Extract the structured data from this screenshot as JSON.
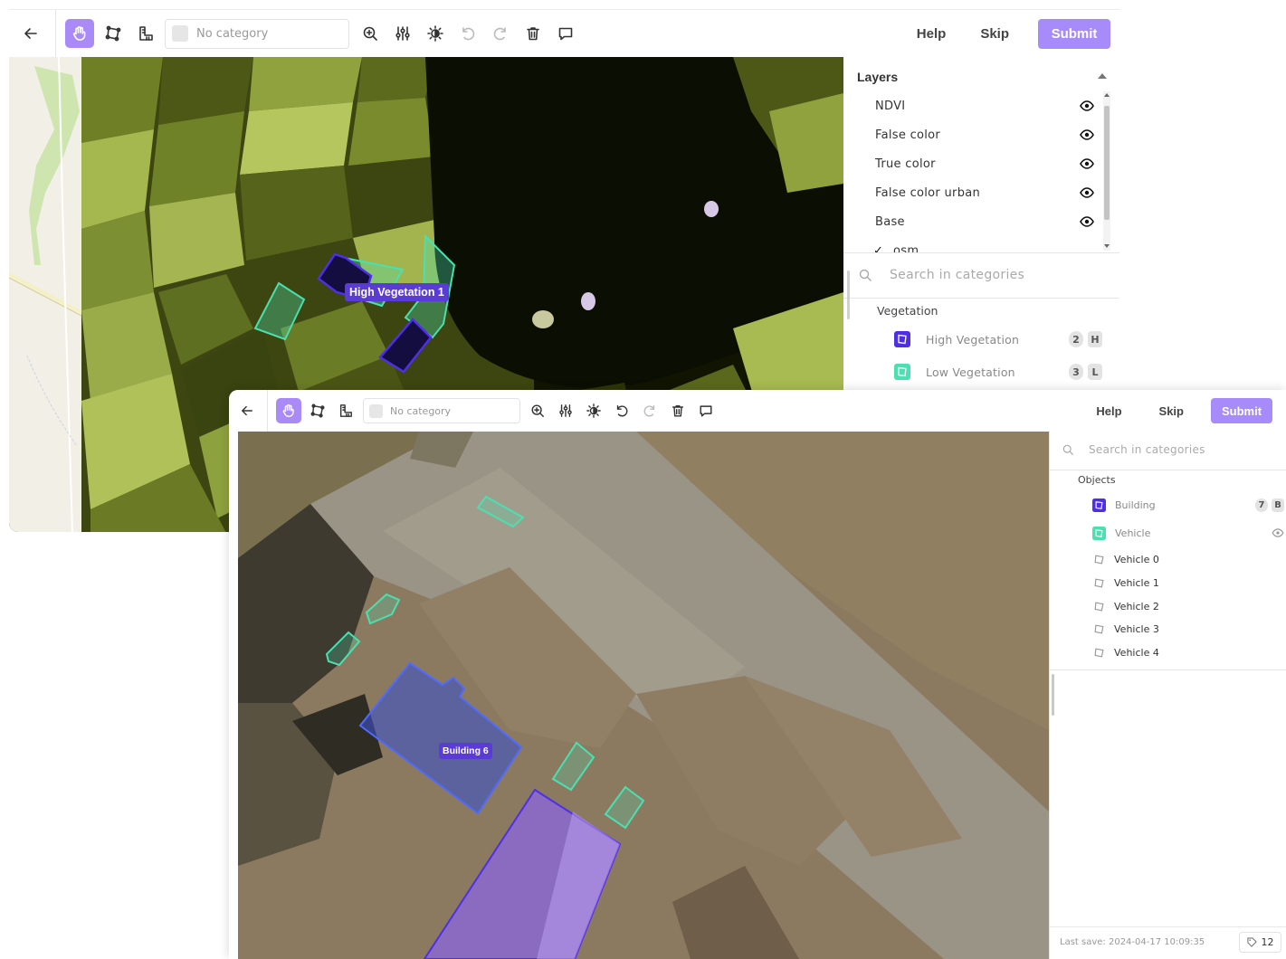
{
  "colors": {
    "accent": "#a78bfa",
    "high_vegetation": "#4f2ee8",
    "low_vegetation": "#4ae0b0",
    "building": "#4f2ee8",
    "vehicle": "#4ae0b0"
  },
  "window1": {
    "toolbar": {
      "category_placeholder": "No category",
      "help_label": "Help",
      "skip_label": "Skip",
      "submit_label": "Submit"
    },
    "layers": {
      "title": "Layers",
      "items": [
        {
          "label": "NDVI",
          "visible": true
        },
        {
          "label": "False color",
          "visible": true
        },
        {
          "label": "True color",
          "visible": true
        },
        {
          "label": "False color urban",
          "visible": true
        },
        {
          "label": "Base",
          "visible": true
        },
        {
          "label": "osm",
          "checked": true
        }
      ]
    },
    "search": {
      "placeholder": "Search in categories"
    },
    "categories": {
      "group_label": "Vegetation",
      "items": [
        {
          "label": "High Vegetation",
          "count": "2",
          "hotkey": "H"
        },
        {
          "label": "Low Vegetation",
          "count": "3",
          "hotkey": "L"
        }
      ]
    },
    "map_label": "High Vegetation 1"
  },
  "window2": {
    "toolbar": {
      "category_placeholder": "No category",
      "help_label": "Help",
      "skip_label": "Skip",
      "submit_label": "Submit"
    },
    "search": {
      "placeholder": "Search in categories"
    },
    "objects": {
      "group_label": "Objects",
      "categories": [
        {
          "label": "Building",
          "count": "7",
          "hotkey": "B"
        },
        {
          "label": "Vehicle"
        }
      ],
      "instances": [
        {
          "label": "Vehicle 0"
        },
        {
          "label": "Vehicle 1"
        },
        {
          "label": "Vehicle 2"
        },
        {
          "label": "Vehicle 3"
        },
        {
          "label": "Vehicle 4"
        }
      ]
    },
    "map_label": "Building 6",
    "footer": {
      "last_save": "Last save: 2024-04-17 10:09:35",
      "tag_count": "12"
    }
  }
}
